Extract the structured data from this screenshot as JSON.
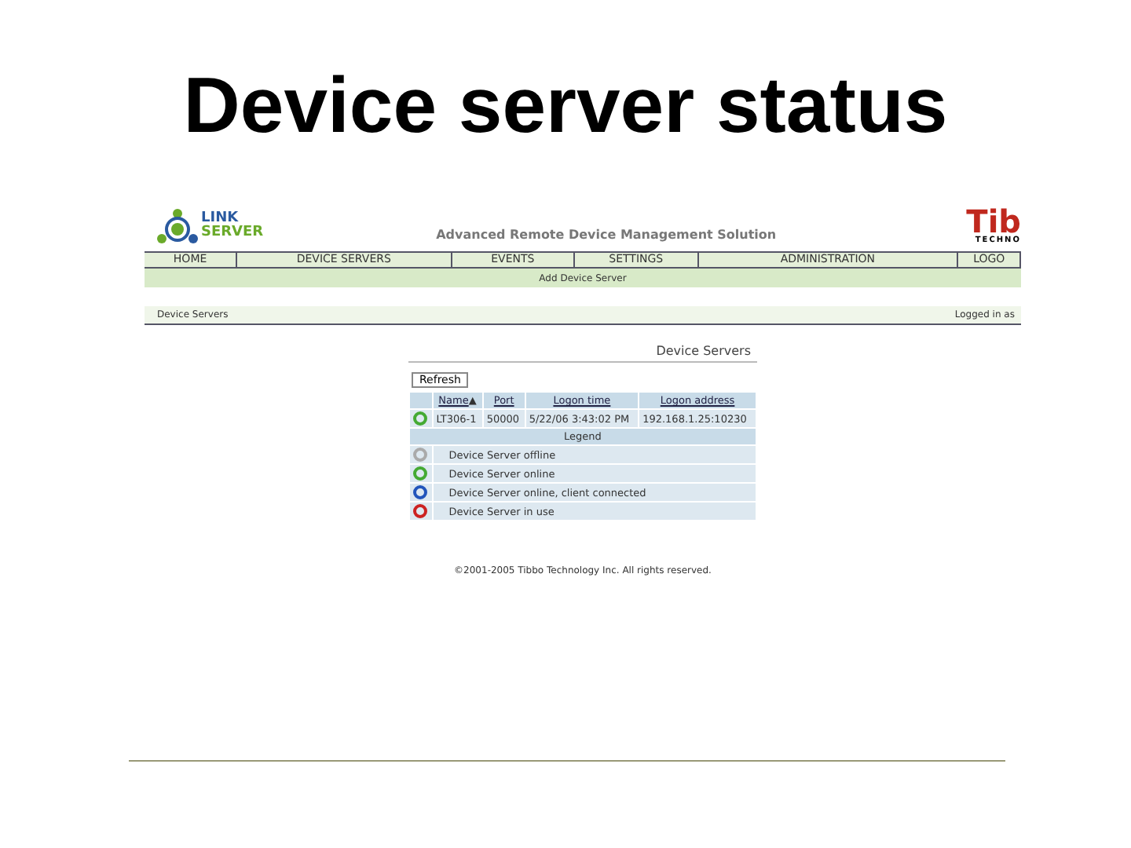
{
  "slide": {
    "title": "Device server status"
  },
  "header": {
    "logo_top": "LINK",
    "logo_bottom": "SERVER",
    "title": "Advanced Remote Device Management Solution",
    "brand": "Tib",
    "brand_sub": "TECHNO"
  },
  "nav": [
    {
      "label": "HOME"
    },
    {
      "label": "DEVICE SERVERS"
    },
    {
      "label": "EVENTS"
    },
    {
      "label": "SETTINGS"
    },
    {
      "label": "ADMINISTRATION"
    },
    {
      "label": "LOGO"
    }
  ],
  "subnav": {
    "link": "Add Device Server"
  },
  "breadcrumb": {
    "left": "Device Servers",
    "right": "Logged in as"
  },
  "panel": {
    "title": "Device Servers",
    "refresh": "Refresh",
    "columns": [
      {
        "label": "Name",
        "sort_arrow": "▲"
      },
      {
        "label": "Port"
      },
      {
        "label": "Logon time"
      },
      {
        "label": "Logon address"
      }
    ],
    "rows": [
      {
        "color": "#44aa33",
        "cells": [
          "LT306-1",
          "50000",
          "5/22/06 3:43:02 PM",
          "192.168.1.25:10230"
        ]
      }
    ],
    "legend_title": "Legend",
    "legend": [
      {
        "color": "#aaaaaa",
        "label": "Device Server offline"
      },
      {
        "color": "#44aa33",
        "label": "Device Server online"
      },
      {
        "color": "#2255bb",
        "label": "Device Server online, client connected"
      },
      {
        "color": "#cc2222",
        "label": "Device Server in use"
      }
    ]
  },
  "footer": "©2001-2005 Tibbo Technology Inc. All rights reserved."
}
